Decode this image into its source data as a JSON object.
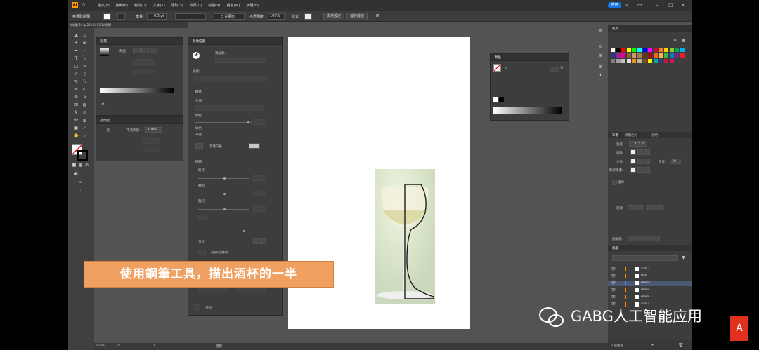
{
  "menubar": {
    "logo": "Ai",
    "items": [
      "檔案(F)",
      "編輯(E)",
      "物件(O)",
      "文字(T)",
      "選取(S)",
      "效果(C)",
      "檢視(V)",
      "視窗(W)",
      "說明(H)"
    ],
    "share_label": "共用"
  },
  "control_bar": {
    "selection_label": "無選取範圍",
    "stroke_label": "筆畫:",
    "stroke_value": "0.5 pt",
    "brush_label": "5 點圓形",
    "opacity_label": "不透明度:",
    "opacity_value": "100%",
    "style_label": "樣式:",
    "doc_setup_label": "文件設定",
    "prefs_label": "偏好設定"
  },
  "document_tab": {
    "title": "未標題-1* @ 250 % (RGB/預覽)"
  },
  "gradient_panel": {
    "title": "漸層",
    "type_label": "類型:",
    "gradient_colors": [
      "#ffffff",
      "#000000"
    ]
  },
  "transparency_panel": {
    "title": "透明度",
    "mode": "一般",
    "opacity_label": "不透明度:",
    "opacity_value": "100%"
  },
  "image_trace_panel": {
    "title": "影像描圖",
    "preset_label": "預設集:",
    "view_label": "檢視:",
    "mode_label": "模式:",
    "palette_label": "色盤:",
    "colors_label": "顏色:",
    "advanced_label": "進階",
    "paths_label": "路徑",
    "corners_label": "轉角",
    "noise_label": "雜訊",
    "method_label": "方式:",
    "fills_label": "填色",
    "strokes_label": "筆畫",
    "snap_label": "曲線與直線對齊",
    "ignore_white_label": "忽略白色",
    "preview_label": "預視"
  },
  "color_panel": {
    "title": "顏色",
    "value_label": "K",
    "value_unit": "%"
  },
  "swatches_panel": {
    "title": "色票",
    "colors": [
      "#ffffff",
      "#000000",
      "#ff0000",
      "#ffff00",
      "#00ff00",
      "#00ffff",
      "#0000ff",
      "#ff00ff",
      "#c8102e",
      "#f47d20",
      "#ffd100",
      "#8dc63f",
      "#00a651",
      "#00aeef",
      "#2e3192",
      "#92278f",
      "#ec008c",
      "#8b5e3c",
      "#c69c6d",
      "#a67c52",
      "#603913",
      "#9e0b0f",
      "#f26522",
      "#fbb040",
      "#39b54a",
      "#1b75bc",
      "#662d91",
      "#ed1c24",
      "#808080",
      "#a0a0a0",
      "#c0c0c0",
      "#e0e0e0",
      "#f7941d",
      "#c2b59b",
      "#754c24",
      "#fff200",
      "#00a99d",
      "#2b3990",
      "#bf1e2e",
      "#d4145a"
    ]
  },
  "stroke_panel": {
    "tabs": [
      "筆畫",
      "漸層色彩",
      "透明"
    ],
    "weight_label": "寬度:",
    "weight_value": "0.5 pt",
    "cap_label": "端點:",
    "corner_label": "尖角:",
    "limit_label": "限度:",
    "limit_value": "10",
    "align_label": "對齊筆畫:",
    "dashed_label": "虛線",
    "arrow_label": "箭頭:",
    "profile_label": "描繪檔:"
  },
  "layers_panel": {
    "title": "圖層",
    "layers": [
      {
        "name": "sub 2",
        "color": "#ff8c00",
        "selected": false
      },
      {
        "name": "tool",
        "color": "#ff8c00",
        "selected": false
      },
      {
        "name": "main 1",
        "color": "#4a90e2",
        "selected": true
      },
      {
        "name": "main 2",
        "color": "#ff8c00",
        "selected": false
      },
      {
        "name": "main 3",
        "color": "#ff8c00",
        "selected": false
      },
      {
        "name": "sub 1",
        "color": "#ff8c00",
        "selected": false
      }
    ],
    "count_label": "8 個圖層"
  },
  "status_bar": {
    "zoom": "250%",
    "rotation": "0°",
    "artboard": "1",
    "tool_label": "選取"
  },
  "subtitle": "使用鋼筆工具，描出酒杯的一半",
  "watermark": "GABG人工智能应用"
}
